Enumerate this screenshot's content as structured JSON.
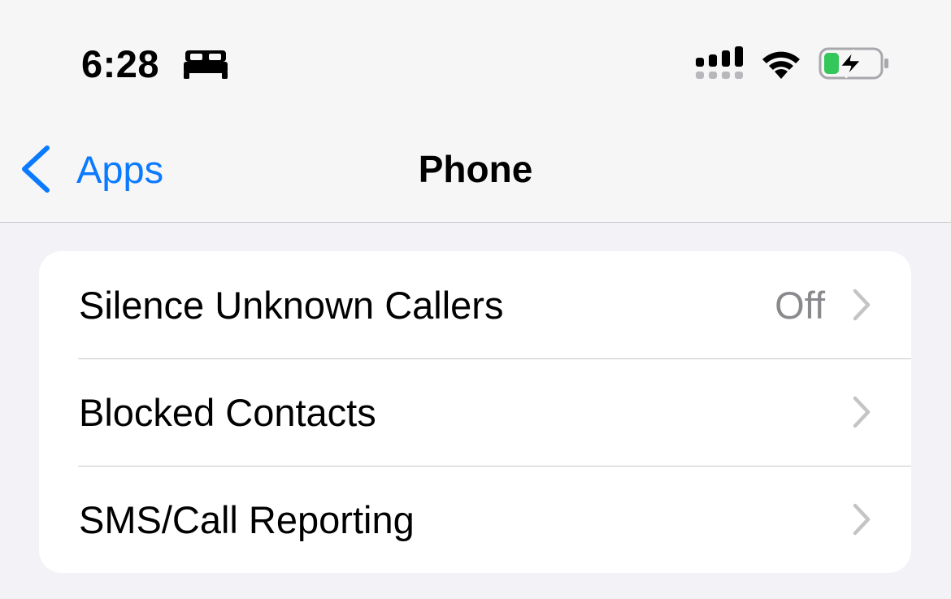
{
  "status_bar": {
    "time": "6:28",
    "focus_icon": "bed-icon",
    "signal_icon": "cellular-signal-icon",
    "wifi_icon": "wifi-icon",
    "battery_icon": "battery-charging-icon",
    "battery_fill_color": "#34c759"
  },
  "nav": {
    "back_label": "Apps",
    "title": "Phone",
    "accent_color": "#0a7aff"
  },
  "settings": {
    "rows": [
      {
        "label": "Silence Unknown Callers",
        "value": "Off"
      },
      {
        "label": "Blocked Contacts",
        "value": ""
      },
      {
        "label": "SMS/Call Reporting",
        "value": ""
      }
    ]
  }
}
